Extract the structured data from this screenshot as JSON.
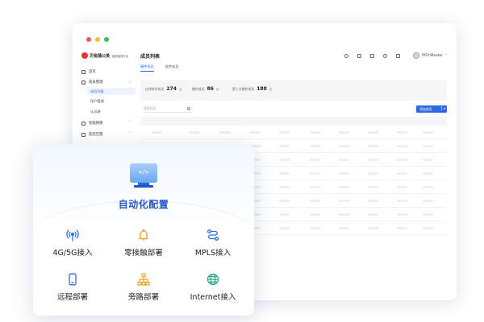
{
  "console": {
    "brand_name": "贝锐蒲公英",
    "brand_sub": "智能管理平台",
    "nav": [
      {
        "label": "首页"
      },
      {
        "label": "成员管理",
        "expanded": true
      },
      {
        "label": "智能网络"
      },
      {
        "label": "监控告警"
      }
    ],
    "sub_nav": [
      {
        "label": "成员列表",
        "active": true
      },
      {
        "label": "用户管理"
      },
      {
        "label": "认证源"
      }
    ],
    "page_title": "成员列表",
    "user_name": "PGY-Master",
    "tabs": [
      {
        "label": "硬件成员",
        "active": true
      },
      {
        "label": "软件成员",
        "active": false
      }
    ],
    "stats": [
      {
        "label": "在线软件成员",
        "value": "274",
        "unit": "台"
      },
      {
        "label": "硬件成员",
        "value": "86",
        "unit": "台"
      },
      {
        "label": "第三方硬件成员",
        "value": "188",
        "unit": "台"
      }
    ],
    "search_placeholder": "搜索成员",
    "add_button_label": "添加成员",
    "colors": {
      "accent": "#2f68e5",
      "brand": "#e2382f"
    }
  },
  "card": {
    "hero_icon": "code-monitor-icon",
    "title": "自动化配置",
    "features": [
      {
        "label": "4G/5G接入",
        "icon": "signal-tower-icon"
      },
      {
        "label": "零接触部署",
        "icon": "bell-icon"
      },
      {
        "label": "MPLS接入",
        "icon": "route-icon"
      },
      {
        "label": "远程部署",
        "icon": "mobile-phone-icon"
      },
      {
        "label": "旁路部署",
        "icon": "network-tree-icon"
      },
      {
        "label": "Internet接入",
        "icon": "globe-icon"
      }
    ],
    "colors": {
      "title": "#2257c6",
      "icon": "#2f6fe6"
    }
  }
}
